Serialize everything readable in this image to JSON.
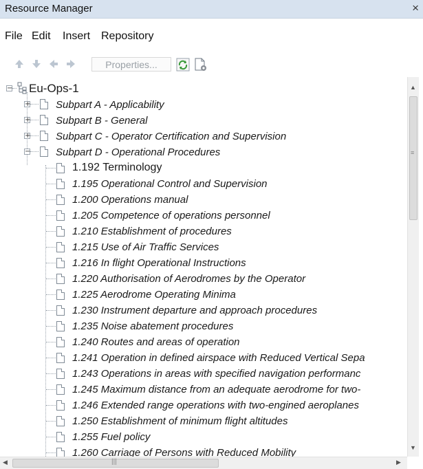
{
  "window": {
    "title": "Resource Manager",
    "close_glyph": "×"
  },
  "menu": [
    "File",
    "Edit",
    "Insert",
    "Repository"
  ],
  "toolbar": {
    "properties_label": "Properties...",
    "nav_icons": [
      "arrow-up-icon",
      "arrow-down-icon",
      "arrow-left-icon",
      "arrow-right-icon"
    ],
    "refresh_icon": "refresh-icon",
    "settings_icon": "document-settings-icon"
  },
  "tree": {
    "root": "Eu-Ops-1",
    "subparts": [
      {
        "label": "Subpart A - Applicability",
        "state": "collapsed"
      },
      {
        "label": "Subpart B - General",
        "state": "collapsed"
      },
      {
        "label": "Subpart C - Operator Certification and Supervision",
        "state": "collapsed"
      },
      {
        "label": "Subpart D - Operational Procedures",
        "state": "expanded"
      }
    ],
    "items": [
      "1.192 Terminology",
      "1.195 Operational Control and Supervision",
      "1.200 Operations manual",
      "1.205 Competence of operations personnel",
      "1.210 Establishment of procedures",
      "1.215 Use of Air Traffic Services",
      "1.216 In flight Operational Instructions",
      "1.220 Authorisation of Aerodromes by the Operator",
      "1.225 Aerodrome Operating Minima",
      "1.230 Instrument departure and approach procedures",
      "1.235 Noise abatement procedures",
      "1.240 Routes and areas of operation",
      "1.241 Operation in defined airspace with Reduced Vertical Sepa",
      "1.243 Operations in areas with specified navigation performanc",
      "1.245 Maximum distance from an adequate aerodrome for two-",
      "1.246 Extended range operations with two-engined aeroplanes",
      "1.250 Establishment of minimum flight altitudes",
      "1.255 Fuel policy",
      "1.260 Carriage of Persons with Reduced Mobility"
    ]
  },
  "scrollbars": {
    "vertical": {
      "position": 0.0
    },
    "horizontal": {
      "position": 0.0
    }
  }
}
